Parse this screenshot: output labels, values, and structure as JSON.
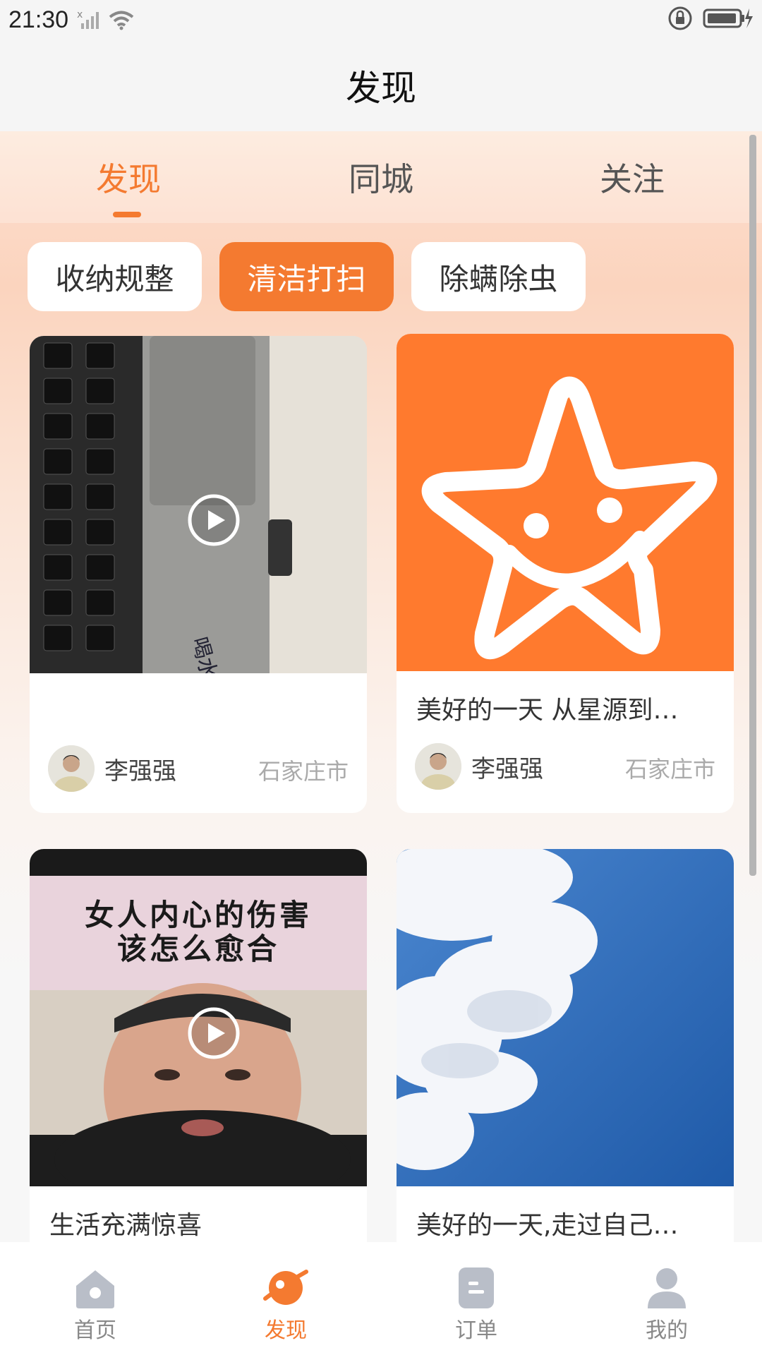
{
  "status_bar": {
    "time": "21:30"
  },
  "header": {
    "title": "发现"
  },
  "tabs": [
    {
      "label": "发现",
      "active": true
    },
    {
      "label": "同城",
      "active": false
    },
    {
      "label": "关注",
      "active": false
    }
  ],
  "chips": [
    {
      "label": "收纳规整",
      "active": false
    },
    {
      "label": "清洁打扫",
      "active": true
    },
    {
      "label": "除螨除虫",
      "active": false
    }
  ],
  "cards": [
    {
      "title": "",
      "author": "李强强",
      "city": "石家庄市",
      "type": "video",
      "media": "keyboard-laptop"
    },
    {
      "title": "美好的一天 从星源到…",
      "author": "李强强",
      "city": "石家庄市",
      "type": "image",
      "media": "orange-star-logo"
    },
    {
      "title": "生活充满惊喜",
      "type": "video",
      "media": "man-talking",
      "overlay_lines": [
        "女人内心的伤害",
        "该怎么愈合"
      ]
    },
    {
      "title": "美好的一天,走过自己…",
      "type": "image",
      "media": "sky-clouds"
    }
  ],
  "bottom_nav": [
    {
      "label": "首页",
      "icon": "home-icon",
      "active": false
    },
    {
      "label": "发现",
      "icon": "planet-icon",
      "active": true
    },
    {
      "label": "订单",
      "icon": "order-icon",
      "active": false
    },
    {
      "label": "我的",
      "icon": "profile-icon",
      "active": false
    }
  ],
  "colors": {
    "accent": "#f47a30",
    "inactive": "#888888",
    "star_bg": "#ff7a2e",
    "sky": "#2f6fbd"
  }
}
